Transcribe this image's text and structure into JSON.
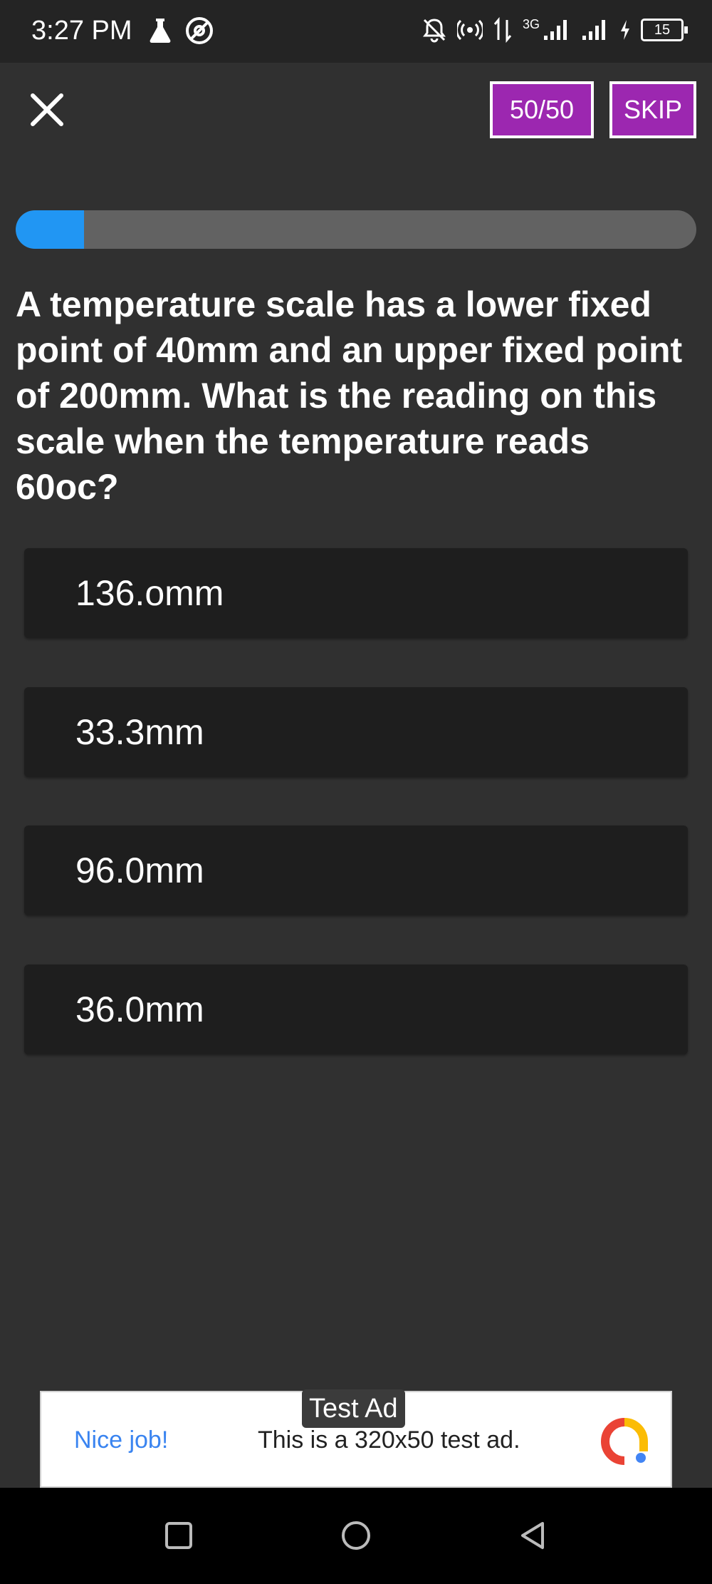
{
  "status_bar": {
    "time": "3:27 PM",
    "icons": [
      "flask-icon",
      "at-icon",
      "bell-off-icon",
      "hotspot-icon",
      "data-arrows-icon",
      "signal-3g-icon",
      "signal-icon",
      "charging-icon"
    ],
    "network": "3G",
    "battery": "15"
  },
  "header": {
    "close_icon": "close-icon",
    "fifty_fifty_label": "50/50",
    "skip_label": "SKIP"
  },
  "progress": {
    "value": 0.1
  },
  "question": {
    "text": "A temperature scale has a lower fixed point of 40mm and an upper fixed point of 200mm. What is the reading on this scale when the temperature reads 60oc?"
  },
  "options": [
    {
      "label": "136.omm"
    },
    {
      "label": "33.3mm"
    },
    {
      "label": "96.0mm"
    },
    {
      "label": "36.0mm"
    }
  ],
  "ad": {
    "badge": "Test Ad",
    "left_text": "Nice job!",
    "body_text": "This is a 320x50 test ad."
  },
  "nav": {
    "icons": [
      "recents-icon",
      "home-icon",
      "back-icon"
    ]
  },
  "colors": {
    "accent_purple": "#9c27b0",
    "progress_blue": "#2196f3",
    "background": "#303030",
    "option_bg": "#1e1e1e"
  }
}
